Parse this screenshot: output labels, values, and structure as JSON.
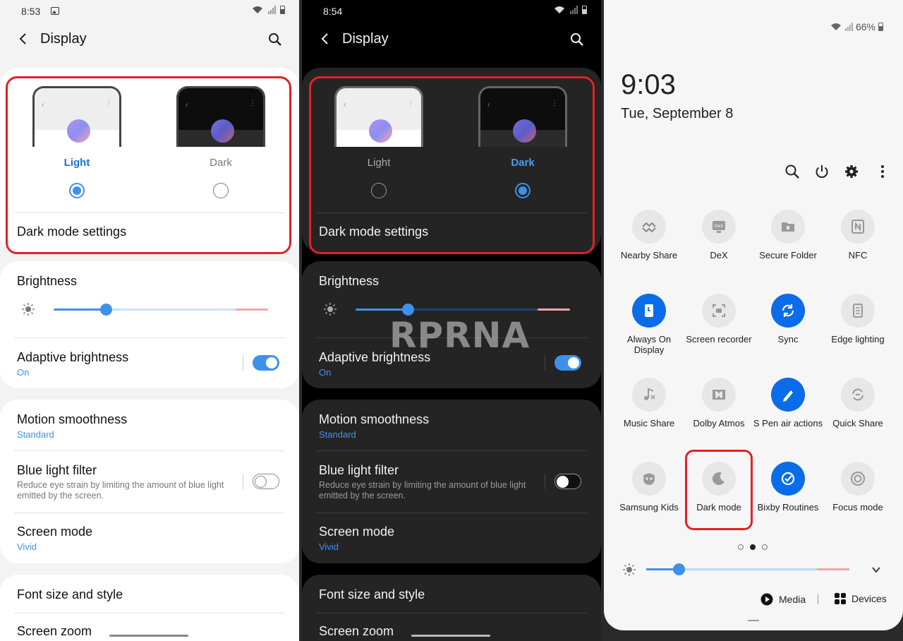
{
  "light": {
    "status": {
      "time": "8:53"
    },
    "header": {
      "title": "Display"
    },
    "theme": {
      "light_label": "Light",
      "dark_label": "Dark"
    },
    "dark_mode_settings": "Dark mode settings",
    "brightness": {
      "label": "Brightness",
      "level": 0.25
    },
    "adaptive": {
      "label": "Adaptive brightness",
      "state": "On"
    },
    "motion": {
      "label": "Motion smoothness",
      "value": "Standard"
    },
    "blue_light": {
      "label": "Blue light filter",
      "description": "Reduce eye strain by limiting the amount of blue light emitted by the screen."
    },
    "screen_mode": {
      "label": "Screen mode",
      "value": "Vivid"
    },
    "font": {
      "label": "Font size and style"
    },
    "screen_zoom": {
      "label": "Screen zoom"
    }
  },
  "dark": {
    "status": {
      "time": "8:54"
    },
    "header": {
      "title": "Display"
    },
    "theme": {
      "light_label": "Light",
      "dark_label": "Dark"
    },
    "dark_mode_settings": "Dark mode settings",
    "brightness": {
      "label": "Brightness",
      "level": 0.25
    },
    "adaptive": {
      "label": "Adaptive brightness",
      "state": "On"
    },
    "motion": {
      "label": "Motion smoothness",
      "value": "Standard"
    },
    "blue_light": {
      "label": "Blue light filter",
      "description": "Reduce eye strain by limiting the amount of blue light emitted by the screen."
    },
    "screen_mode": {
      "label": "Screen mode",
      "value": "Vivid"
    },
    "font": {
      "label": "Font size and style"
    },
    "screen_zoom": {
      "label": "Screen zoom"
    },
    "watermark": "RPRNA"
  },
  "quick_panel": {
    "battery": "66%",
    "time": "9:03",
    "date": "Tue, September 8",
    "tiles": [
      {
        "label": "Nearby Share",
        "icon": "nearby-share-icon",
        "on": false
      },
      {
        "label": "DeX",
        "icon": "dex-icon",
        "on": false
      },
      {
        "label": "Secure Folder",
        "icon": "secure-folder-icon",
        "on": false
      },
      {
        "label": "NFC",
        "icon": "nfc-icon",
        "on": false
      },
      {
        "label": "Always On Display",
        "icon": "always-on-display-icon",
        "on": true
      },
      {
        "label": "Screen recorder",
        "icon": "screen-recorder-icon",
        "on": false
      },
      {
        "label": "Sync",
        "icon": "sync-icon",
        "on": true
      },
      {
        "label": "Edge lighting",
        "icon": "edge-lighting-icon",
        "on": false
      },
      {
        "label": "Music Share",
        "icon": "music-share-icon",
        "on": false
      },
      {
        "label": "Dolby Atmos",
        "icon": "dolby-atmos-icon",
        "on": false
      },
      {
        "label": "S Pen air actions",
        "icon": "s-pen-icon",
        "on": true
      },
      {
        "label": "Quick Share",
        "icon": "quick-share-icon",
        "on": false
      },
      {
        "label": "Samsung Kids",
        "icon": "samsung-kids-icon",
        "on": false
      },
      {
        "label": "Dark mode",
        "icon": "moon-icon",
        "on": false
      },
      {
        "label": "Bixby Routines",
        "icon": "bixby-routines-icon",
        "on": true
      },
      {
        "label": "Focus mode",
        "icon": "focus-mode-icon",
        "on": false
      }
    ],
    "page_indicator": {
      "pages": 3,
      "current": 2
    },
    "brightness_level": 0.16,
    "media_label": "Media",
    "devices_label": "Devices"
  },
  "colors": {
    "accent": "#3e91ea",
    "highlight": "#e12226",
    "tile_on": "#0a6ce8"
  }
}
